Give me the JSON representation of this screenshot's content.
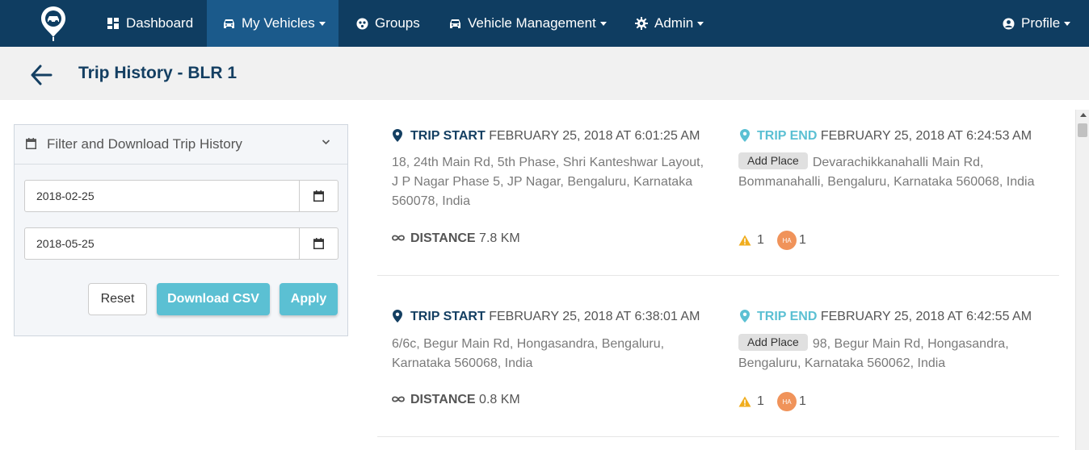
{
  "nav": {
    "logo": "locator-pin-logo",
    "items": [
      {
        "label": "Dashboard",
        "icon": "dashboard-icon"
      },
      {
        "label": "My Vehicles",
        "icon": "car-icon",
        "dropdown": true,
        "active": true
      },
      {
        "label": "Groups",
        "icon": "groups-icon"
      },
      {
        "label": "Vehicle Management",
        "icon": "car-icon",
        "dropdown": true
      },
      {
        "label": "Admin",
        "icon": "gear-icon",
        "dropdown": true
      },
      {
        "label": "Profile",
        "icon": "user-circle-icon",
        "dropdown": true
      }
    ]
  },
  "page": {
    "title": "Trip History - BLR 1"
  },
  "filter": {
    "title": "Filter and Download Trip History",
    "start_date": "2018-02-25",
    "end_date": "2018-05-25",
    "reset_label": "Reset",
    "csv_label": "Download CSV",
    "apply_label": "Apply"
  },
  "labels": {
    "trip_start": "TRIP START",
    "trip_end": "TRIP END",
    "distance": "DISTANCE",
    "add_place": "Add Place",
    "ha_badge": "HA"
  },
  "trips": [
    {
      "start_time": "FEBRUARY 25, 2018 AT 6:01:25 AM",
      "start_address": "18, 24th Main Rd, 5th Phase, Shri Kanteshwar Layout, J P Nagar Phase 5, JP Nagar, Bengaluru, Karnataka 560078, India",
      "end_time": "FEBRUARY 25, 2018 AT 6:24:53 AM",
      "end_address": "Devarachikkanahalli Main Rd, Bommanahalli, Bengaluru, Karnataka 560068, India",
      "distance": "7.8 KM",
      "warnings": "1",
      "harsh_accel": "1"
    },
    {
      "start_time": "FEBRUARY 25, 2018 AT 6:38:01 AM",
      "start_address": "6/6c, Begur Main Rd, Hongasandra, Bengaluru, Karnataka 560068, India",
      "end_time": "FEBRUARY 25, 2018 AT 6:42:55 AM",
      "end_address": "98, Begur Main Rd, Hongasandra, Bengaluru, Karnataka 560062, India",
      "distance": "0.8 KM",
      "warnings": "1",
      "harsh_accel": "1"
    }
  ],
  "colors": {
    "navbar": "#0f3d61",
    "nav_active": "#1b5a8b",
    "title": "#143f62",
    "accent": "#5bc0d3",
    "warning": "#f0ad1e",
    "ha_badge": "#f0935a"
  }
}
